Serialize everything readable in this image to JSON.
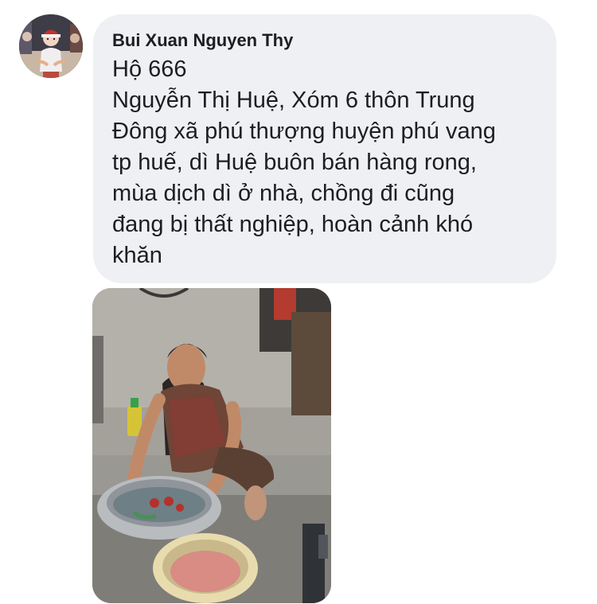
{
  "comment": {
    "author": "Bui Xuan Nguyen Thy",
    "body_lines": [
      "Hộ 666",
      "Nguyễn Thị Huệ, Xóm 6 thôn Trung",
      "Đông xã phú thượng huyện phú vang",
      "tp huế, dì Huệ buôn bán hàng rong,",
      "mùa dịch dì ở nhà, chồng đi cũng",
      "đang bị thất nghiệp, hoàn cảnh khó",
      "khăn"
    ]
  },
  "colors": {
    "bubble_background": "#eff0f3",
    "text": "#1c1e21",
    "page_background": "#ffffff"
  }
}
